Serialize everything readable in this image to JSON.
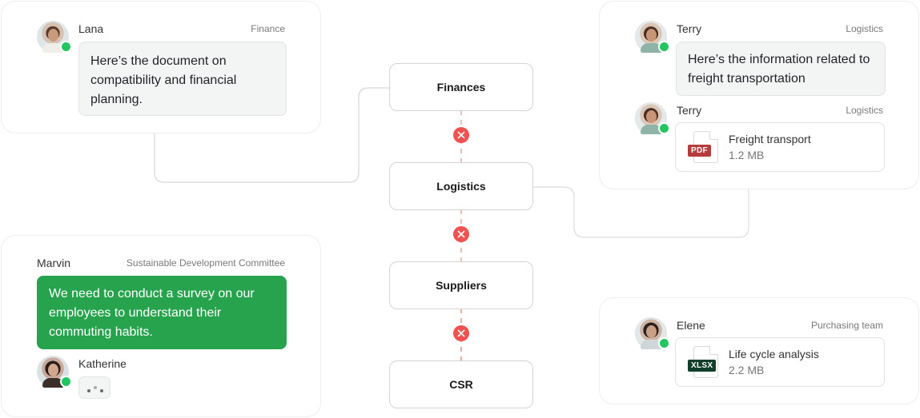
{
  "colors": {
    "accent_green": "#27a34e",
    "online": "#22c55e",
    "blocked_red": "#f05252",
    "pdf_tag": "#b63b3b",
    "xlsx_tag": "#123f2b"
  },
  "flow": {
    "nodes": [
      {
        "label": "Finances"
      },
      {
        "label": "Logistics"
      },
      {
        "label": "Suppliers"
      },
      {
        "label": "CSR"
      }
    ],
    "links": [
      {
        "from": "Finances",
        "to": "Logistics",
        "status": "blocked",
        "icon": "close-icon"
      },
      {
        "from": "Logistics",
        "to": "Suppliers",
        "status": "blocked",
        "icon": "close-icon"
      },
      {
        "from": "Suppliers",
        "to": "CSR",
        "status": "blocked",
        "icon": "close-icon"
      }
    ]
  },
  "cards": {
    "finance": {
      "messages": [
        {
          "author": "Lana",
          "department": "Finance",
          "online": true,
          "text": "Here’s the document on compatibility and financial planning."
        }
      ]
    },
    "logistics": {
      "messages": [
        {
          "author": "Terry",
          "department": "Logistics",
          "online": true,
          "text": "Here’s the information related to freight transportation"
        },
        {
          "author": "Terry",
          "department": "Logistics",
          "online": true,
          "file": {
            "name": "Freight transport",
            "size": "1.2 MB",
            "type": "PDF",
            "icon": "pdf-file-icon"
          }
        }
      ]
    },
    "csr": {
      "messages": [
        {
          "author": "Marvin",
          "department": "Sustainable Development Committee",
          "text": "We need to conduct a survey on our employees to understand their commuting habits."
        },
        {
          "author": "Katherine",
          "online": true,
          "typing": true,
          "icon": "typing-indicator-icon"
        }
      ]
    },
    "purchasing": {
      "messages": [
        {
          "author": "Elene",
          "department": "Purchasing team",
          "online": true,
          "file": {
            "name": "Life cycle analysis",
            "size": "2.2 MB",
            "type": "XLSX",
            "icon": "xlsx-file-icon"
          }
        }
      ]
    }
  }
}
